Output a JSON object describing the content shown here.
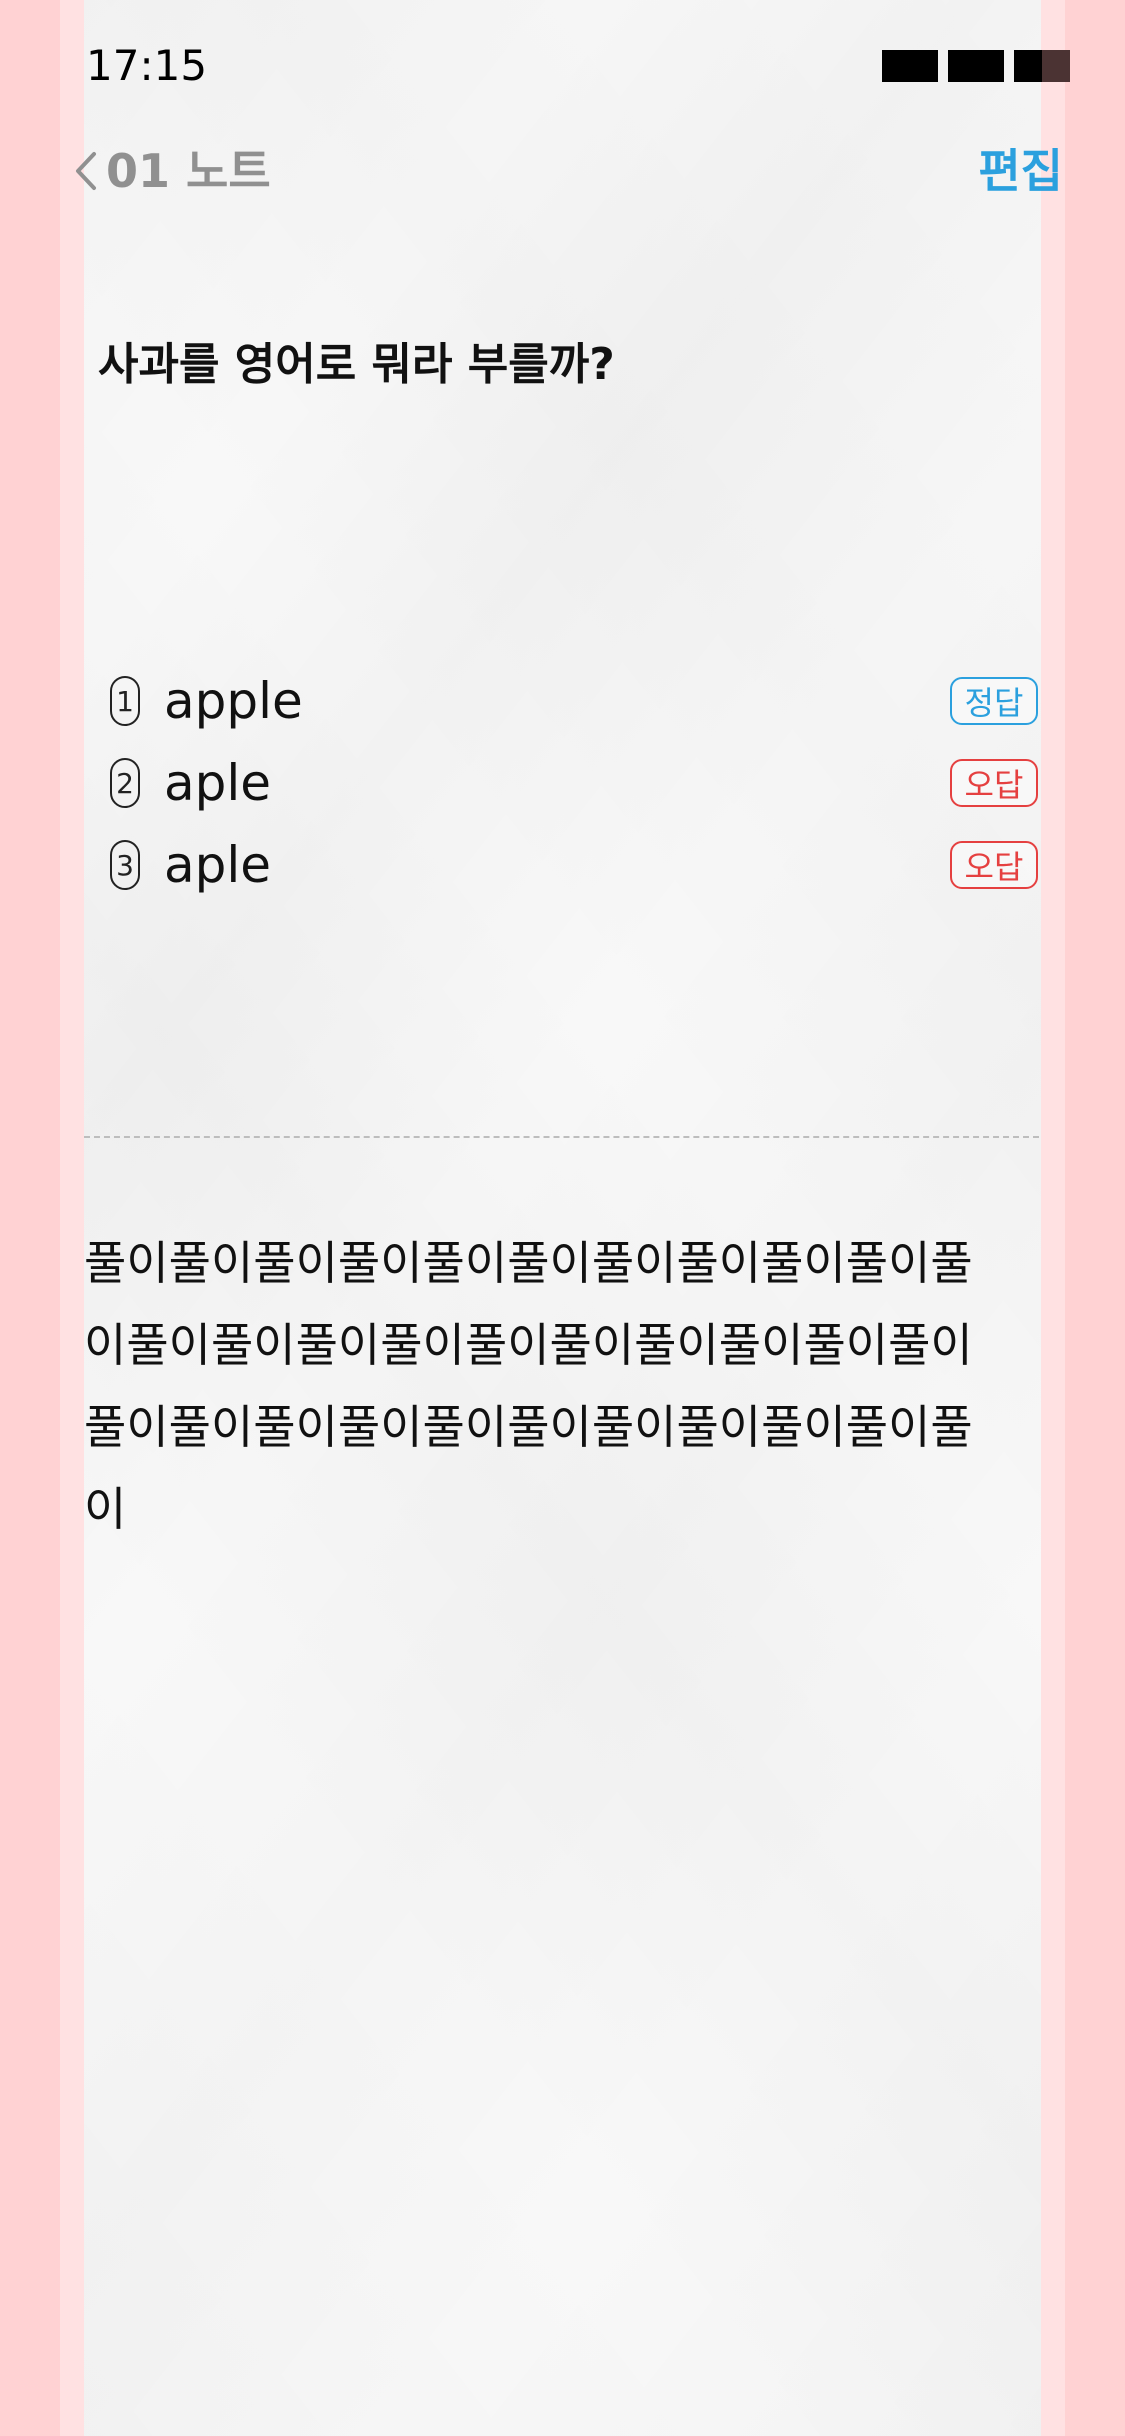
{
  "status_bar": {
    "time": "17:15",
    "icons": [
      "cellular-signal-icon",
      "wifi-icon",
      "battery-icon"
    ]
  },
  "nav": {
    "back_icon": "chevron-left-icon",
    "back_label": "01 노트",
    "edit_label": "편집"
  },
  "question": {
    "text": "사과를 영어로 뭐라 부를까?"
  },
  "options": [
    {
      "number": "1",
      "text": "apple",
      "result": "정답",
      "status": "correct"
    },
    {
      "number": "2",
      "text": "aple",
      "result": "오답",
      "status": "wrong"
    },
    {
      "number": "3",
      "text": "aple",
      "result": "오답",
      "status": "wrong"
    }
  ],
  "explanation": {
    "text": "풀이풀이풀이풀이풀이풀이풀이풀이풀이풀이풀이풀이풀이풀이풀이풀이풀이풀이풀이풀이풀이풀이풀이풀이풀이풀이풀이풀이풀이풀이풀이풀이"
  },
  "colors": {
    "background": "#ffd2d3",
    "paper": "#f8f8f8",
    "accent": "#2ba0de",
    "correct": "#2ba0de",
    "wrong": "#e54040",
    "muted": "#909090"
  }
}
